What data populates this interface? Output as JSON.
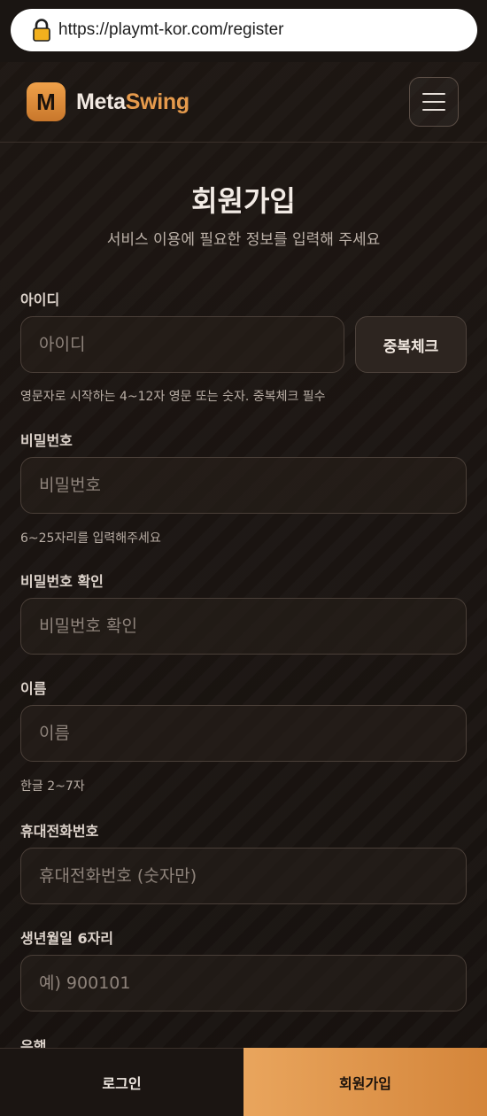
{
  "browser": {
    "url": "https://playmt-kor.com/register"
  },
  "header": {
    "logo_letter": "M",
    "brand_part1": "Meta",
    "brand_part2": "Swing"
  },
  "page": {
    "title": "회원가입",
    "subtitle": "서비스 이용에 필요한 정보를 입력해 주세요"
  },
  "form": {
    "userid": {
      "label": "아이디",
      "placeholder": "아이디",
      "value": "",
      "button": "중복체크",
      "hint": "영문자로 시작하는 4~12자 영문 또는 숫자. 중복체크 필수"
    },
    "password": {
      "label": "비밀번호",
      "placeholder": "비밀번호",
      "value": "",
      "hint": "6~25자리를 입력해주세요"
    },
    "password_confirm": {
      "label": "비밀번호 확인",
      "placeholder": "비밀번호 확인",
      "value": ""
    },
    "name": {
      "label": "이름",
      "placeholder": "이름",
      "value": "",
      "hint": "한글 2~7자"
    },
    "phone": {
      "label": "휴대전화번호",
      "placeholder": "휴대전화번호 (숫자만)",
      "value": ""
    },
    "birth": {
      "label": "생년월일 6자리",
      "placeholder": "예) 900101",
      "value": ""
    },
    "bank": {
      "label": "은행"
    }
  },
  "bottom_nav": {
    "login": "로그인",
    "register": "회원가입"
  },
  "colors": {
    "accent": "#e59a4c",
    "background": "#17120f"
  },
  "icons": {
    "lock": "lock-icon",
    "menu": "hamburger-menu-icon"
  }
}
